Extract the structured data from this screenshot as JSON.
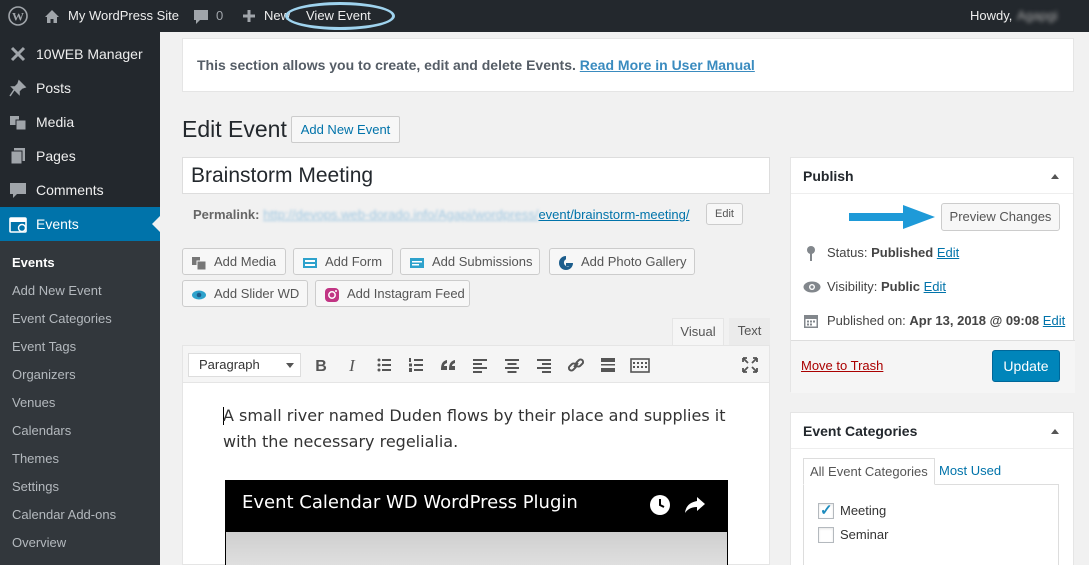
{
  "admin_bar": {
    "site_name": "My WordPress Site",
    "comments_count": "0",
    "new_label": "New",
    "view_event_label": "View Event",
    "howdy_label": "Howdy,",
    "user_name": "Agapgi"
  },
  "sidebar": {
    "items": [
      {
        "label": "10WEB Manager",
        "icon": "10web-icon"
      },
      {
        "label": "Posts",
        "icon": "pushpin-icon"
      },
      {
        "label": "Media",
        "icon": "media-icon"
      },
      {
        "label": "Pages",
        "icon": "pages-icon"
      },
      {
        "label": "Comments",
        "icon": "comments-icon"
      },
      {
        "label": "Events",
        "icon": "calendar-icon"
      }
    ],
    "submenu": [
      "Events",
      "Add New Event",
      "Event Categories",
      "Event Tags",
      "Organizers",
      "Venues",
      "Calendars",
      "Themes",
      "Settings",
      "Calendar Add-ons",
      "Overview"
    ]
  },
  "notice": {
    "text": "This section allows you to create, edit and delete Events.",
    "link": "Read More in User Manual"
  },
  "page": {
    "title": "Edit Event",
    "add_new_label": "Add New Event",
    "post_title": "Brainstorm Meeting",
    "permalink_label": "Permalink:",
    "permalink_blurred": "http://devops.web-dorado.info/Agapi/wordpress/",
    "permalink_slug": "event/brainstorm-meeting/",
    "edit_slug_label": "Edit"
  },
  "media_buttons": [
    "Add Media",
    "Add Form",
    "Add Submissions",
    "Add Photo Gallery",
    "Add Slider WD",
    "Add Instagram Feed"
  ],
  "editor": {
    "tabs": {
      "visual": "Visual",
      "text": "Text"
    },
    "format_value": "Paragraph",
    "toolbar_icons": [
      "bold-icon",
      "italic-icon",
      "bullet-list-icon",
      "numbered-list-icon",
      "blockquote-icon",
      "align-left-icon",
      "align-center-icon",
      "align-right-icon",
      "link-icon",
      "read-more-icon",
      "toolbar-toggle-icon",
      "fullscreen-icon"
    ],
    "bold_glyph": "B",
    "italic_glyph": "I",
    "body_text": "A small river named Duden flows by their place and supplies it with the necessary regelialia.",
    "video_title": "Event Calendar WD WordPress Plugin"
  },
  "publish": {
    "title": "Publish",
    "preview_label": "Preview Changes",
    "status_label": "Status:",
    "status_value": "Published",
    "visibility_label": "Visibility:",
    "visibility_value": "Public",
    "published_label": "Published on:",
    "published_value": "Apr 13, 2018 @ 09:08",
    "edit_label": "Edit",
    "trash_label": "Move to Trash",
    "update_label": "Update",
    "arrow_color": "#1e9ad8"
  },
  "event_categories": {
    "title": "Event Categories",
    "tab_all": "All Event Categories",
    "tab_used": "Most Used",
    "items": [
      {
        "label": "Meeting",
        "checked": true
      },
      {
        "label": "Seminar",
        "checked": false
      }
    ]
  },
  "colors": {
    "admin_bar": "#23282d",
    "accent": "#0073aa",
    "primary_button": "#0085ba"
  }
}
